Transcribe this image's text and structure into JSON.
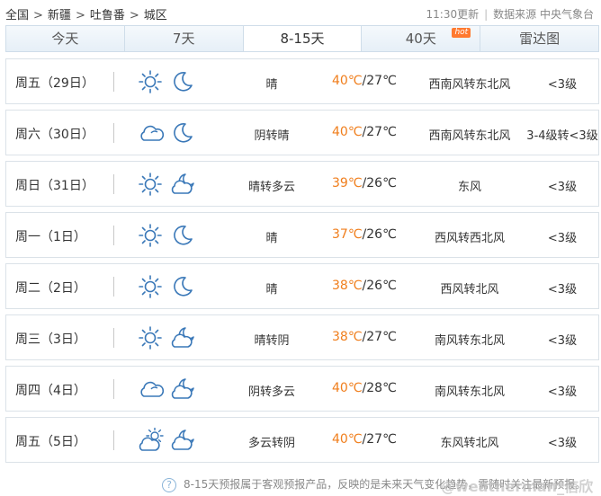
{
  "breadcrumb": {
    "items": [
      "全国",
      "新疆",
      "吐鲁番",
      "城区"
    ],
    "separator": ">"
  },
  "header": {
    "update_time": "11:30更新",
    "source": "数据来源 中央气象台"
  },
  "tabs": [
    {
      "label": "今天",
      "active": false
    },
    {
      "label": "7天",
      "active": false
    },
    {
      "label": "8-15天",
      "active": true
    },
    {
      "label": "40天",
      "active": false,
      "badge": "hot"
    },
    {
      "label": "雷达图",
      "active": false
    }
  ],
  "forecast": [
    {
      "day": "周五（29日）",
      "icons": [
        "sun-icon",
        "moon-icon"
      ],
      "condition": "晴",
      "high": "40℃",
      "low": "/27℃",
      "wind": "西南风转东北风",
      "level": "<3级"
    },
    {
      "day": "周六（30日）",
      "icons": [
        "cloud-icon",
        "moon-icon"
      ],
      "condition": "阴转晴",
      "high": "40℃",
      "low": "/27℃",
      "wind": "西南风转东北风",
      "level": "3-4级转<3级"
    },
    {
      "day": "周日（31日）",
      "icons": [
        "sun-icon",
        "cloud-moon-icon"
      ],
      "condition": "晴转多云",
      "high": "39℃",
      "low": "/26℃",
      "wind": "东风",
      "level": "<3级"
    },
    {
      "day": "周一（1日）",
      "icons": [
        "sun-icon",
        "moon-icon"
      ],
      "condition": "晴",
      "high": "37℃",
      "low": "/26℃",
      "wind": "西风转西北风",
      "level": "<3级"
    },
    {
      "day": "周二（2日）",
      "icons": [
        "sun-icon",
        "moon-icon"
      ],
      "condition": "晴",
      "high": "38℃",
      "low": "/26℃",
      "wind": "西风转北风",
      "level": "<3级"
    },
    {
      "day": "周三（3日）",
      "icons": [
        "sun-icon",
        "cloud-moon-icon"
      ],
      "condition": "晴转阴",
      "high": "38℃",
      "low": "/27℃",
      "wind": "南风转东北风",
      "level": "<3级"
    },
    {
      "day": "周四（4日）",
      "icons": [
        "cloud-icon",
        "cloud-moon-icon"
      ],
      "condition": "阴转多云",
      "high": "40℃",
      "low": "/28℃",
      "wind": "南风转东北风",
      "level": "<3级"
    },
    {
      "day": "周五（5日）",
      "icons": [
        "cloud-sun-icon",
        "cloud-moon-icon"
      ],
      "condition": "多云转阴",
      "high": "40℃",
      "low": "/27℃",
      "wind": "东风转北风",
      "level": "<3级"
    }
  ],
  "footer": {
    "note": "8-15天预报属于客观预报产品，反映的是未来天气变化趋势，需随时关注最新预报。",
    "watermark": "@weatherman_信欣"
  },
  "colors": {
    "high_temp": "#f07e1c",
    "icon_stroke": "#3a78b8",
    "tab_border": "#cfdde9",
    "hot_badge": "#ff7a2f"
  }
}
